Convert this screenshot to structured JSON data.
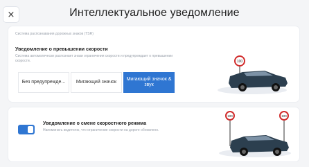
{
  "header": {
    "title": "Интеллектуальное уведомление",
    "close_symbol": "×"
  },
  "speed_warning": {
    "system_note": "Система распознавания дорожных знаков (TSR)",
    "title": "Уведомление о превышении скорости",
    "description": "Система автоматически распознает знаки ограничения скорости и предупреждает о превышении скорости.",
    "options": [
      {
        "label": "Без предупрежде...",
        "selected": false
      },
      {
        "label": "Мигающий значок",
        "selected": false
      },
      {
        "label": "Мигающий значок & звук",
        "selected": true
      }
    ]
  },
  "limit_change": {
    "toggle_on": true,
    "title": "Уведомление о смене скоростного режима",
    "description": "Напоминать водителю, что ограничение скорости на дороге обновлено."
  },
  "illustrations": {
    "sign_text": "100",
    "car_color": "#2c3f4f",
    "accent_color": "#2f76d2"
  }
}
